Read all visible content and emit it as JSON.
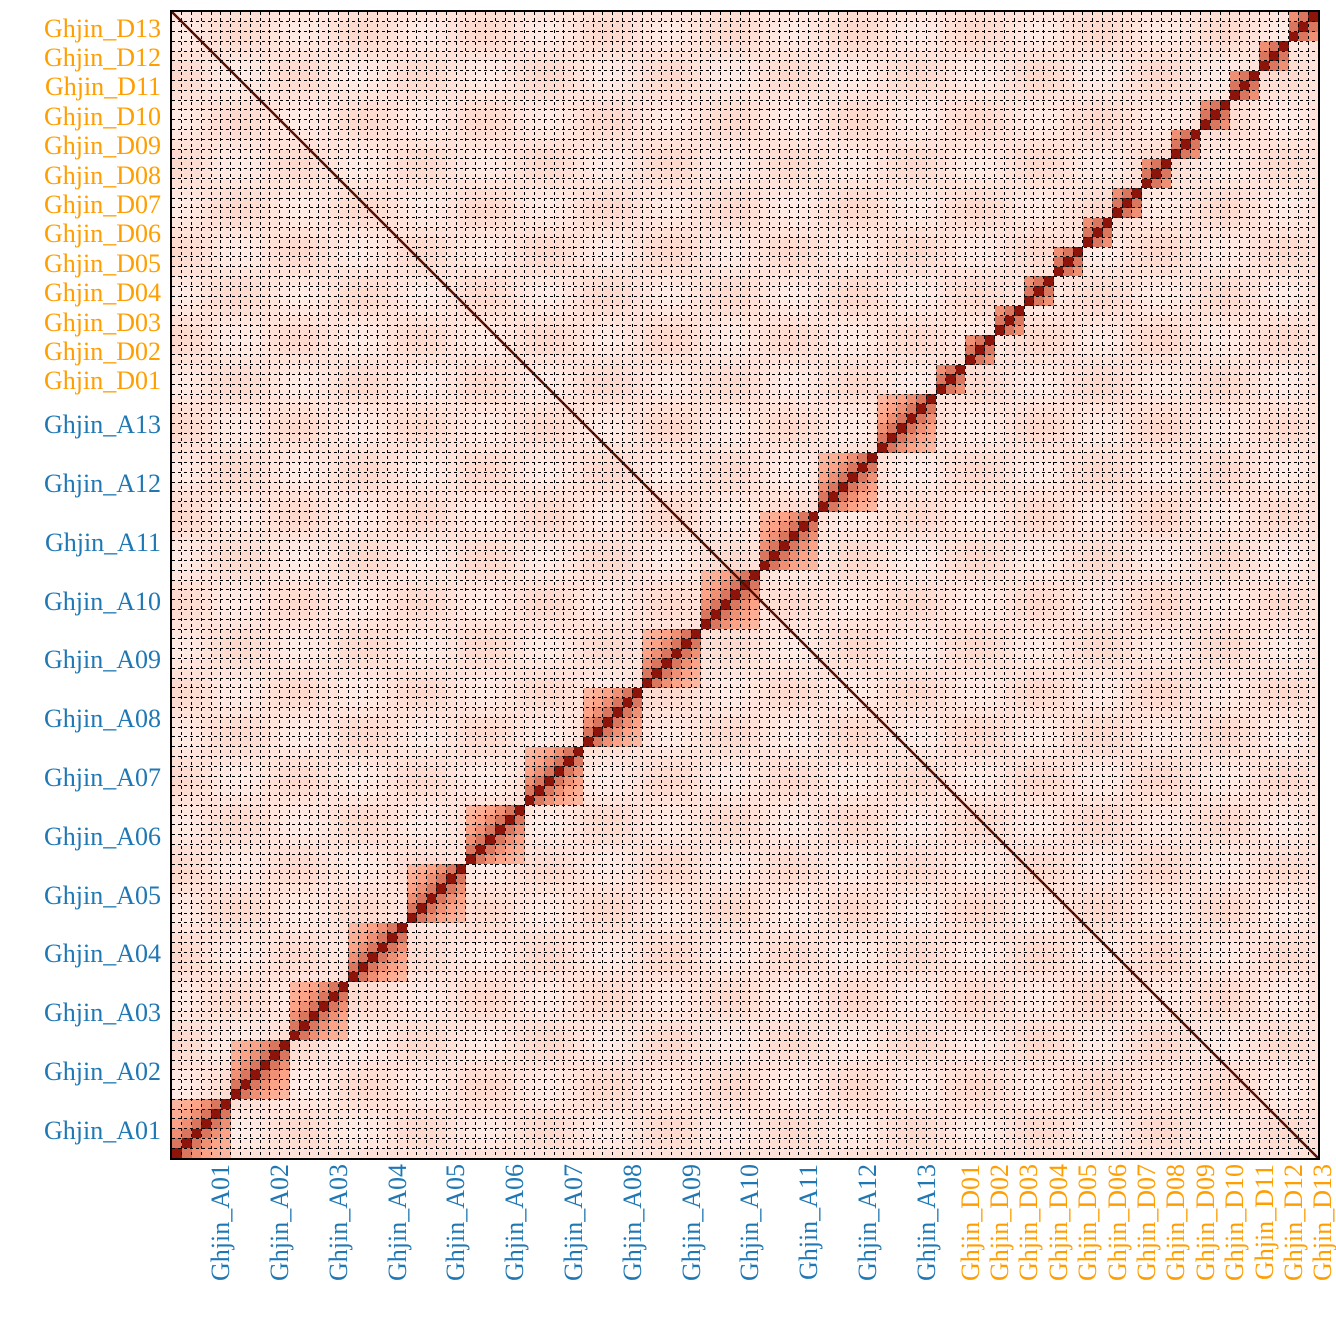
{
  "chart_data": {
    "type": "heatmap",
    "description": "Symmetric contact / similarity matrix. Strong diagonal; block-structure within each chromosome/group; background interactions low.",
    "colormap": "white→salmon→darkred (low→high)",
    "groups": [
      {
        "name": "A",
        "color": "blue",
        "count": 13,
        "size": 2
      },
      {
        "name": "D",
        "color": "orange",
        "count": 13,
        "size": 1
      }
    ],
    "labels": [
      "Ghjin_A01",
      "Ghjin_A02",
      "Ghjin_A03",
      "Ghjin_A04",
      "Ghjin_A05",
      "Ghjin_A06",
      "Ghjin_A07",
      "Ghjin_A08",
      "Ghjin_A09",
      "Ghjin_A10",
      "Ghjin_A11",
      "Ghjin_A12",
      "Ghjin_A13",
      "Ghjin_D01",
      "Ghjin_D02",
      "Ghjin_D03",
      "Ghjin_D04",
      "Ghjin_D05",
      "Ghjin_D06",
      "Ghjin_D07",
      "Ghjin_D08",
      "Ghjin_D09",
      "Ghjin_D10",
      "Ghjin_D11",
      "Ghjin_D12",
      "Ghjin_D13"
    ],
    "value_range": [
      0,
      1
    ],
    "legend": {
      "diagonal": 1.0,
      "same_group_block": 0.55,
      "subblock": 0.35,
      "background": 0.15
    }
  },
  "ylabels": [
    {
      "text": "Ghjin_A01",
      "cls": "blue"
    },
    {
      "text": "Ghjin_A02",
      "cls": "blue"
    },
    {
      "text": "Ghjin_A03",
      "cls": "blue"
    },
    {
      "text": "Ghjin_A04",
      "cls": "blue"
    },
    {
      "text": "Ghjin_A05",
      "cls": "blue"
    },
    {
      "text": "Ghjin_A06",
      "cls": "blue"
    },
    {
      "text": "Ghjin_A07",
      "cls": "blue"
    },
    {
      "text": "Ghjin_A08",
      "cls": "blue"
    },
    {
      "text": "Ghjin_A09",
      "cls": "blue"
    },
    {
      "text": "Ghjin_A10",
      "cls": "blue"
    },
    {
      "text": "Ghjin_A11",
      "cls": "blue"
    },
    {
      "text": "Ghjin_A12",
      "cls": "blue"
    },
    {
      "text": "Ghjin_A13",
      "cls": "blue"
    },
    {
      "text": "Ghjin_D01",
      "cls": "orange"
    },
    {
      "text": "Ghjin_D02",
      "cls": "orange"
    },
    {
      "text": "Ghjin_D03",
      "cls": "orange"
    },
    {
      "text": "Ghjin_D04",
      "cls": "orange"
    },
    {
      "text": "Ghjin_D05",
      "cls": "orange"
    },
    {
      "text": "Ghjin_D06",
      "cls": "orange"
    },
    {
      "text": "Ghjin_D07",
      "cls": "orange"
    },
    {
      "text": "Ghjin_D08",
      "cls": "orange"
    },
    {
      "text": "Ghjin_D09",
      "cls": "orange"
    },
    {
      "text": "Ghjin_D10",
      "cls": "orange"
    },
    {
      "text": "Ghjin_D11",
      "cls": "orange"
    },
    {
      "text": "Ghjin_D12",
      "cls": "orange"
    },
    {
      "text": "Ghjin_D13",
      "cls": "orange"
    }
  ],
  "xlabels": [
    {
      "text": "Ghjin_A01",
      "cls": "blue"
    },
    {
      "text": "Ghjin_A02",
      "cls": "blue"
    },
    {
      "text": "Ghjin_A03",
      "cls": "blue"
    },
    {
      "text": "Ghjin_A04",
      "cls": "blue"
    },
    {
      "text": "Ghjin_A05",
      "cls": "blue"
    },
    {
      "text": "Ghjin_A06",
      "cls": "blue"
    },
    {
      "text": "Ghjin_A07",
      "cls": "blue"
    },
    {
      "text": "Ghjin_A08",
      "cls": "blue"
    },
    {
      "text": "Ghjin_A09",
      "cls": "blue"
    },
    {
      "text": "Ghjin_A10",
      "cls": "blue"
    },
    {
      "text": "Ghjin_A11",
      "cls": "blue"
    },
    {
      "text": "Ghjin_A12",
      "cls": "blue"
    },
    {
      "text": "Ghjin_A13",
      "cls": "blue"
    },
    {
      "text": "Ghjin_D01",
      "cls": "orange"
    },
    {
      "text": "Ghjin_D02",
      "cls": "orange"
    },
    {
      "text": "Ghjin_D03",
      "cls": "orange"
    },
    {
      "text": "Ghjin_D04",
      "cls": "orange"
    },
    {
      "text": "Ghjin_D05",
      "cls": "orange"
    },
    {
      "text": "Ghjin_D06",
      "cls": "orange"
    },
    {
      "text": "Ghjin_D07",
      "cls": "orange"
    },
    {
      "text": "Ghjin_D08",
      "cls": "orange"
    },
    {
      "text": "Ghjin_D09",
      "cls": "orange"
    },
    {
      "text": "Ghjin_D10",
      "cls": "orange"
    },
    {
      "text": "Ghjin_D11",
      "cls": "orange"
    },
    {
      "text": "Ghjin_D12",
      "cls": "orange"
    },
    {
      "text": "Ghjin_D13",
      "cls": "orange"
    }
  ]
}
